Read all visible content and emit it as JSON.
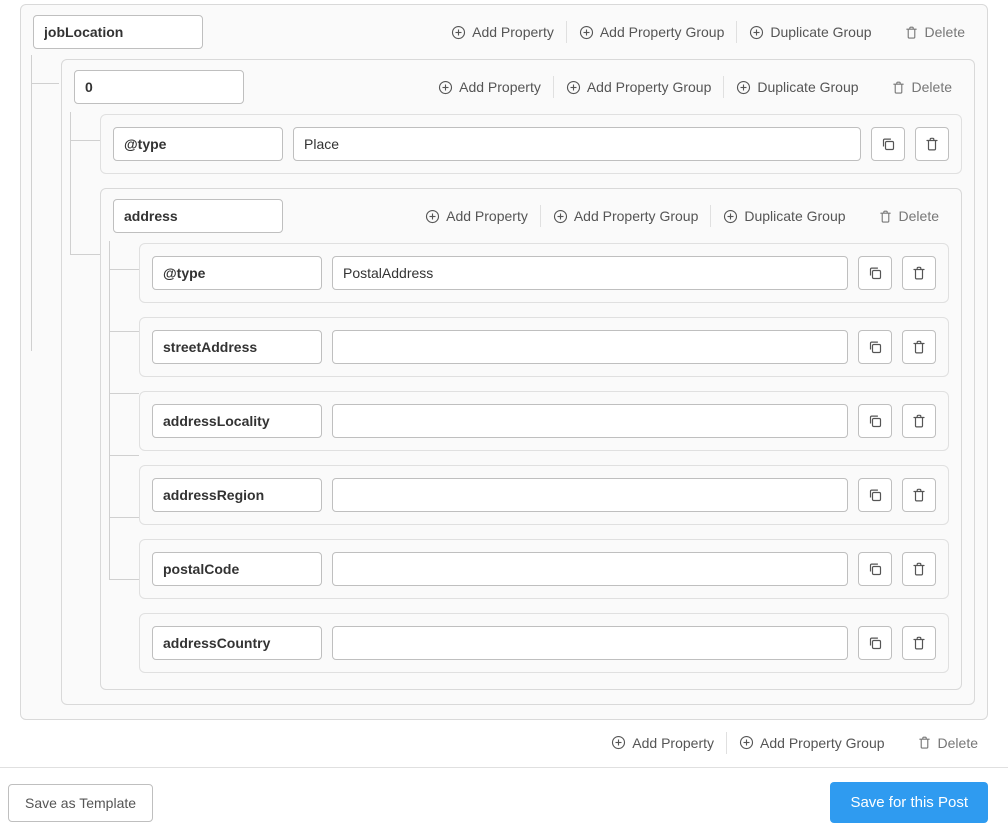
{
  "actions": {
    "add_property": "Add Property",
    "add_property_group": "Add Property Group",
    "duplicate_group": "Duplicate Group",
    "delete": "Delete"
  },
  "root": {
    "key": "jobLocation",
    "child0": {
      "key": "0",
      "type_prop": {
        "key": "@type",
        "value": "Place"
      },
      "address_group": {
        "key": "address",
        "props": {
          "type": {
            "key": "@type",
            "value": "PostalAddress"
          },
          "streetAddress": {
            "key": "streetAddress",
            "value": ""
          },
          "addressLocality": {
            "key": "addressLocality",
            "value": ""
          },
          "addressRegion": {
            "key": "addressRegion",
            "value": ""
          },
          "postalCode": {
            "key": "postalCode",
            "value": ""
          },
          "addressCountry": {
            "key": "addressCountry",
            "value": ""
          }
        }
      }
    }
  },
  "footer": {
    "save_template": "Save as Template",
    "save_post": "Save for this Post"
  }
}
